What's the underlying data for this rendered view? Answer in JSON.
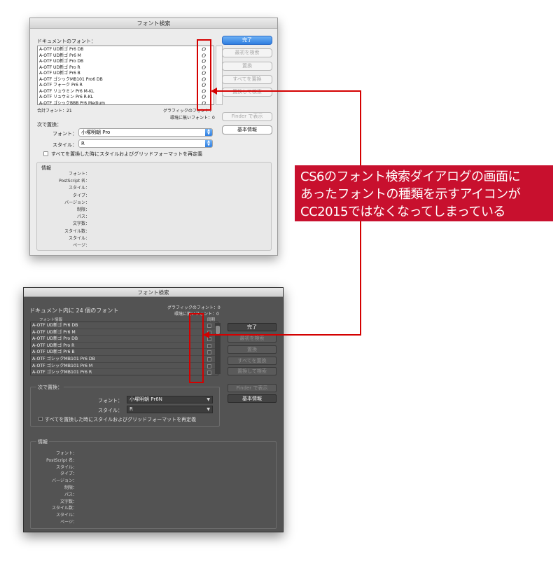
{
  "cs6": {
    "title": "フォント検索",
    "doc_fonts_label": "ドキュメントのフォント：",
    "fonts": [
      "A-OTF UD新ゴ Pr6 DB",
      "A-OTF UD新ゴ Pr6 M",
      "A-OTF UD新ゴ Pro DB",
      "A-OTF UD新ゴ Pro R",
      "A-OTF UD新ゴ Pr6 B",
      "A-OTF ゴシックMB101 Pro6 DB",
      "A-OTF フォーク Pr6 R",
      "A-OTF リュウミン Pr6 M-KL",
      "A-OTF リュウミン Pr6 R-KL",
      "A-OTF ゴシックBBB Pr6 Medium"
    ],
    "opentype_glyph": "O",
    "total_fonts": "合計フォント：21",
    "graphic_fonts": "グラフィックのフォント：",
    "env_fonts": "環境に無いフォント：0",
    "replace_with": "次で置換：",
    "font_label": "フォント：",
    "font_value": "小塚明朝 Pro",
    "style_label": "スタイル：",
    "style_value": "R",
    "redefine_checkbox": "すべてを置換した時にスタイルおよびグリッドフォーマットを再定義",
    "info_label": "情報",
    "info_keys": [
      "フォント：",
      "PostScript 名：",
      "スタイル：",
      "タイプ：",
      "バージョン：",
      "制限：",
      "パス：",
      "文字数：",
      "スタイル数：",
      "スタイル：",
      "ページ："
    ],
    "buttons": {
      "done": "完了",
      "find_first": "最初を検索",
      "replace": "置換",
      "replace_all": "すべてを置換",
      "replace_find": "置換して検索",
      "reveal_finder": "Finder で表示",
      "more_info": "基本情報"
    }
  },
  "cc": {
    "title": "フォント検索",
    "doc_fonts_label": "ドキュメント内に 24 個のフォント",
    "graphic_fonts": "グラフィックのフォント：0",
    "env_fonts": "環境に無いフォント：0",
    "col_font_info": "フォント情報",
    "col_sync": "同期",
    "fonts": [
      "A-OTF UD新ゴ Pr6 DB",
      "A-OTF UD新ゴ Pr6 M",
      "A-OTF UD新ゴ Pro DB",
      "A-OTF UD新ゴ Pro R",
      "A-OTF UD新ゴ Pr6 B",
      "A-OTF ゴシックMB101 Pr6 DB",
      "A-OTF ゴシックMB101 Pr6 M",
      "A-OTF ゴシックMB101 Pr6 R"
    ],
    "replace_with": "次で置換：",
    "font_label": "フォント：",
    "font_value": "小塚明朝 Pr6N",
    "style_label": "スタイル：",
    "style_value": "R",
    "redefine_checkbox": "すべてを置換した時にスタイルおよびグリッドフォーマットを再定義",
    "info_label": "情報",
    "info_keys": [
      "フォント：",
      "PostScript 名：",
      "スタイル：",
      "タイプ：",
      "バージョン：",
      "制限：",
      "パス：",
      "文字数：",
      "スタイル数：",
      "スタイル：",
      "ページ："
    ],
    "buttons": {
      "done": "完了",
      "find_first": "最初を検索",
      "replace": "置換",
      "replace_all": "すべてを置換",
      "replace_find": "置換して検索",
      "reveal_finder": "Finder で表示",
      "more_info": "基本情報"
    }
  },
  "annotation": {
    "callout_lines": [
      "CS6のフォント検索ダイアログの画面に",
      "あったフォントの種類を示すアイコンが",
      "CC2015ではなくなってしまっている"
    ],
    "callout_color": "#c8102e",
    "line_color": "#d40000"
  }
}
